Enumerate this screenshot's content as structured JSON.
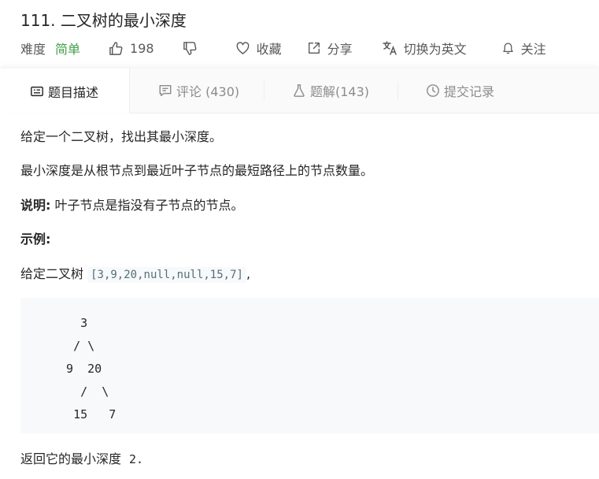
{
  "problem": {
    "title": "111. 二叉树的最小深度",
    "difficulty_label": "难度",
    "difficulty": "简单",
    "likes": "198",
    "collect_label": "收藏",
    "share_label": "分享",
    "switch_label": "切换为英文",
    "follow_label": "关注",
    "difficulty_color": "#43a047"
  },
  "tabs": [
    {
      "label": "题目描述",
      "icon": "description-icon"
    },
    {
      "label": "评论 (430)",
      "icon": "comment-icon"
    },
    {
      "label": "题解(143)",
      "icon": "flask-icon"
    },
    {
      "label": "提交记录",
      "icon": "clock-icon"
    }
  ],
  "content": {
    "p1": "给定一个二叉树，找出其最小深度。",
    "p2": "最小深度是从根节点到最近叶子节点的最短路径上的节点数量。",
    "note_label": "说明:",
    "note_text": " 叶子节点是指没有子节点的节点。",
    "example_label": "示例:",
    "given_prefix": "给定二叉树 ",
    "given_code": "[3,9,20,null,null,15,7]",
    "given_suffix": ",",
    "tree": "    3\n   / \\\n  9  20\n    /  \\\n   15   7",
    "return_prefix": "返回它的最小深度",
    "return_value": "2."
  }
}
